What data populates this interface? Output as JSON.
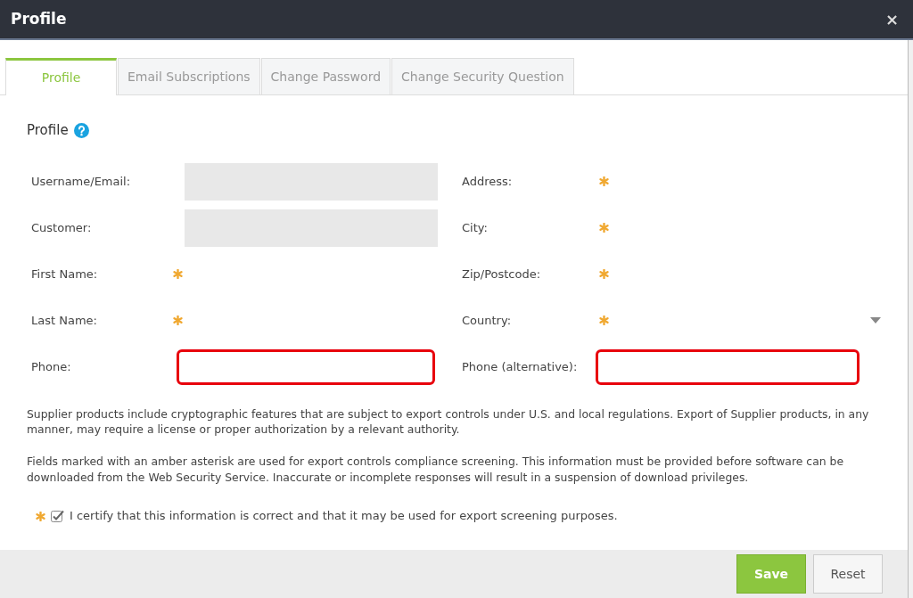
{
  "window": {
    "title": "Profile",
    "close": "×"
  },
  "tabs": [
    {
      "label": "Profile",
      "selected": true
    },
    {
      "label": "Email Subscriptions",
      "selected": false
    },
    {
      "label": "Change Password",
      "selected": false
    },
    {
      "label": "Change Security Question",
      "selected": false
    }
  ],
  "section": {
    "title": "Profile"
  },
  "left_fields": [
    {
      "label": "Username/Email:",
      "kind": "readonly"
    },
    {
      "label": "Customer:",
      "kind": "readonly"
    },
    {
      "label": "First Name:",
      "kind": "required"
    },
    {
      "label": "Last Name:",
      "kind": "required"
    },
    {
      "label": "Phone:",
      "kind": "highlighted"
    }
  ],
  "right_fields": [
    {
      "label": "Address:",
      "kind": "required"
    },
    {
      "label": "City:",
      "kind": "required"
    },
    {
      "label": "Zip/Postcode:",
      "kind": "required"
    },
    {
      "label": "Country:",
      "kind": "dropdown"
    },
    {
      "label": "Phone (alternative):",
      "kind": "highlighted"
    }
  ],
  "notices": [
    "Supplier products include cryptographic features that are subject to export controls under U.S. and local regulations. Export of Supplier products, in any manner, may require a license or proper authorization by a relevant authority.",
    "Fields marked with an amber asterisk are used for export controls compliance screening. This information must be provided before software can be downloaded from the Web Security Service. Inaccurate or incomplete responses will result in a suspension of download privileges."
  ],
  "certify": {
    "label": "I certify that this information is correct and that it may be used for export screening purposes.",
    "checked": true
  },
  "buttons": [
    {
      "label": "Save",
      "kind": "primary"
    },
    {
      "label": "Reset",
      "kind": "secondary"
    }
  ]
}
